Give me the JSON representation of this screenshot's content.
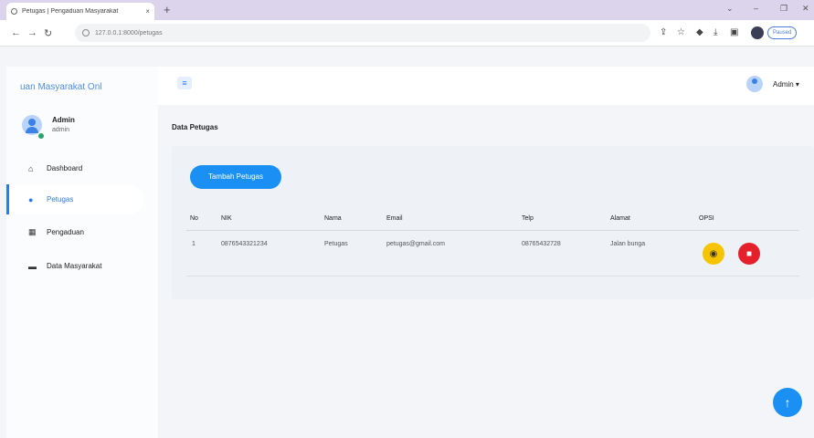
{
  "browser": {
    "tab_title": "Petugas | Pengaduan Masyarakat",
    "tab_close": "×",
    "new_tab": "+",
    "url": "127.0.0.1:8000/petugas",
    "profile_label": "Paused"
  },
  "sidebar": {
    "brand": "uan Masyarakat Onl",
    "user_name": "Admin",
    "user_role": "admin",
    "items": [
      {
        "label": "Dashboard",
        "icon": "home-icon"
      },
      {
        "label": "Petugas",
        "icon": "user-icon",
        "active": true
      },
      {
        "label": "Pengaduan",
        "icon": "table-icon"
      },
      {
        "label": "Data Masyarakat",
        "icon": "id-card-icon"
      }
    ]
  },
  "header": {
    "admin_label": "Admin ▾"
  },
  "main": {
    "page_title": "Data Petugas",
    "add_button": "Tambah Petugas",
    "columns": [
      "No",
      "NIK",
      "Nama",
      "Email",
      "Telp",
      "Alamat",
      "OPSI"
    ],
    "rows": [
      [
        "1",
        "0876543321234",
        "Petugas",
        "petugas@gmail.com",
        "08765432728",
        "Jalan bunga"
      ]
    ]
  },
  "colors": {
    "primary": "#1a90f5",
    "brand_text": "#4f8ee6",
    "view_button": "#f7c400",
    "delete_button": "#e4202b"
  }
}
